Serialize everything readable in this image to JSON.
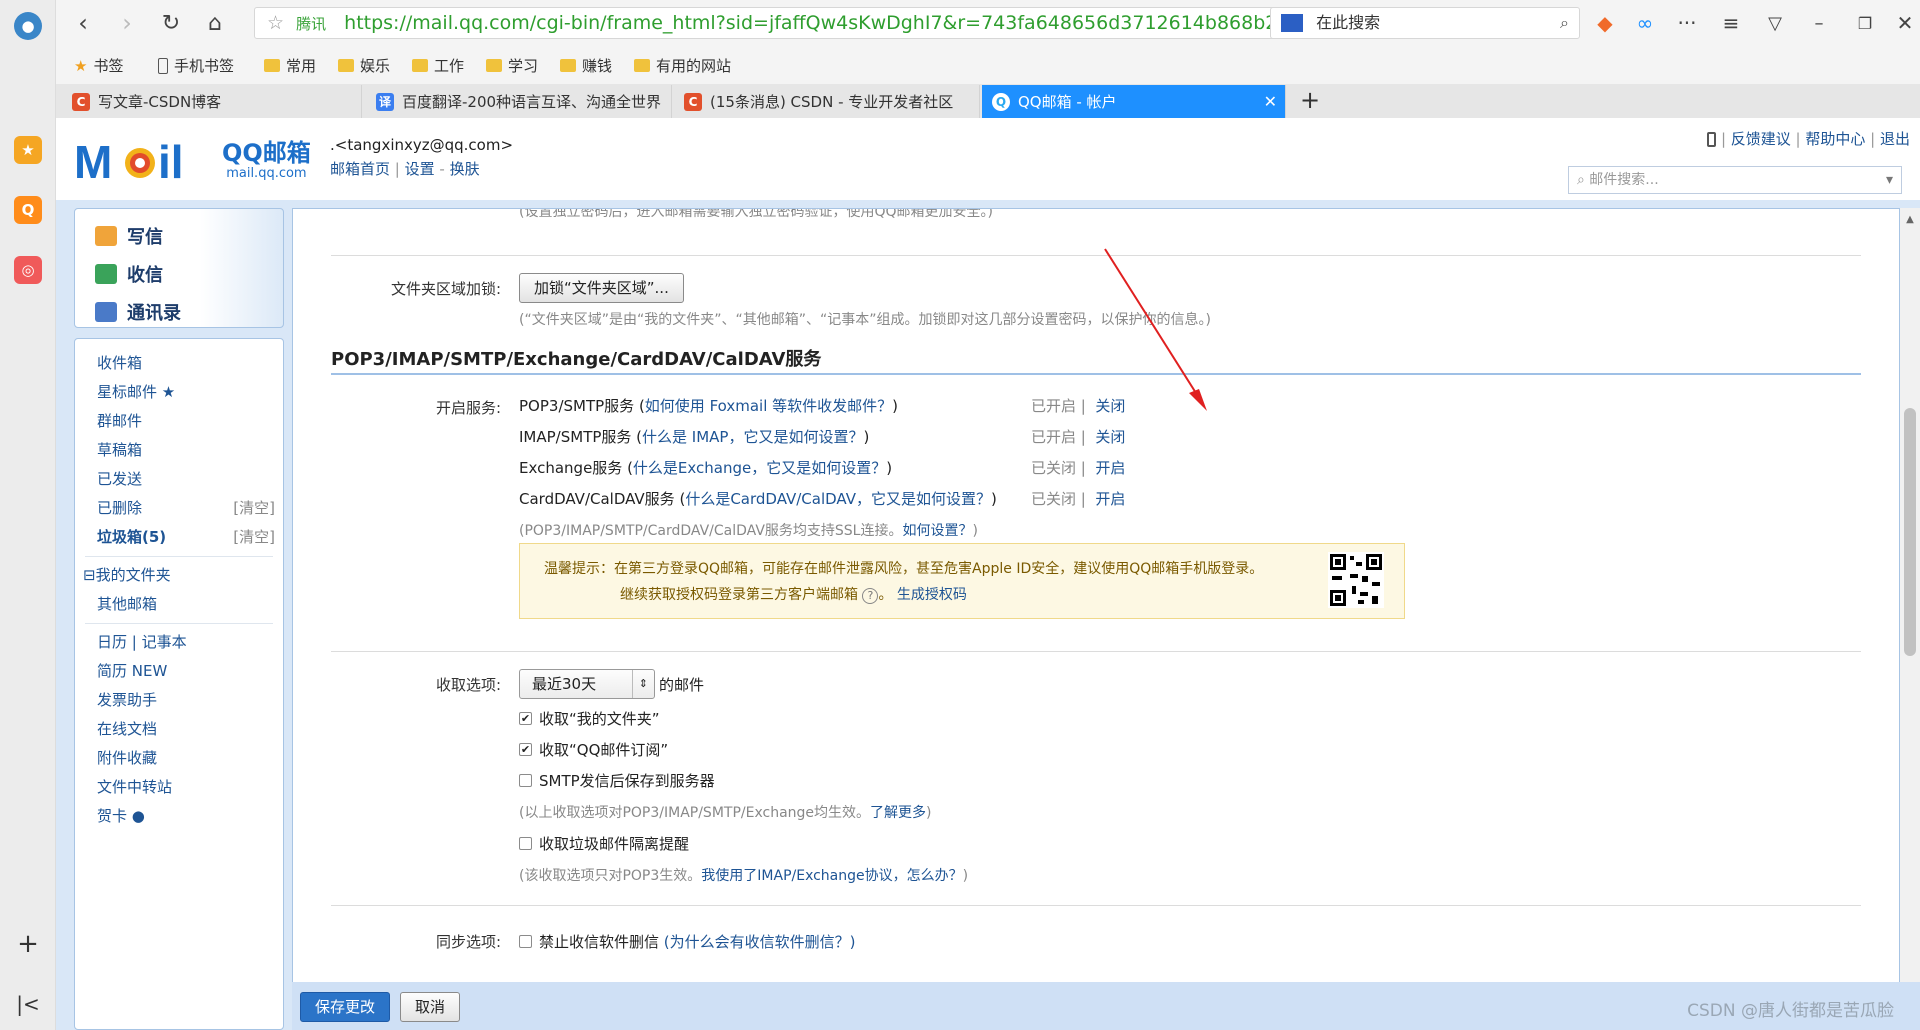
{
  "browser": {
    "brand": "腾讯",
    "url": "https://mail.qq.com/cgi-bin/frame_html?sid=jfaffQw4sKwDghI7&r=743fa648656d3712614b868b2",
    "search_placeholder": "在此搜索",
    "bookmarks": [
      "书签",
      "手机书签",
      "常用",
      "娱乐",
      "工作",
      "学习",
      "赚钱",
      "有用的网站"
    ],
    "tabs": [
      {
        "label": "写文章-CSDN博客",
        "icon": "C",
        "color": "#e2502c"
      },
      {
        "label": "百度翻译-200种语言互译、沟通全世界",
        "icon": "译",
        "color": "#3b7ef0"
      },
      {
        "label": "(15条消息) CSDN - 专业开发者社区",
        "icon": "C",
        "color": "#e2502c"
      },
      {
        "label": "QQ邮箱 - 帐户",
        "icon": "Q",
        "color": "#2aa9f0"
      }
    ],
    "new_tab": "+"
  },
  "mail": {
    "logo_text": "QQ邮箱",
    "logo_sub": "mail.qq.com",
    "user": ".<tangxinxyz@qq.com>",
    "user_links": [
      "邮箱首页",
      "设置",
      "换肤"
    ],
    "top_links": [
      "反馈建议",
      "帮助中心",
      "退出"
    ],
    "search_placeholder": "邮件搜索...",
    "quick": [
      "写信",
      "收信",
      "通讯录"
    ],
    "folders": [
      {
        "name": "收件箱",
        "extra": ""
      },
      {
        "name": "星标邮件 ★",
        "extra": ""
      },
      {
        "name": "群邮件",
        "extra": ""
      },
      {
        "name": "草稿箱",
        "extra": ""
      },
      {
        "name": "已发送",
        "extra": ""
      },
      {
        "name": "已删除",
        "extra": "[清空]"
      },
      {
        "name": "垃圾箱(5)",
        "extra": "[清空]"
      }
    ],
    "my_folders": "⊟我的文件夹",
    "other_mail": "其他邮箱",
    "tools": [
      "日历 | 记事本",
      "简历 NEW",
      "发票助手",
      "在线文档",
      "附件收藏",
      "文件中转站",
      "贺卡 ●"
    ]
  },
  "settings": {
    "top_note": "(设置独立密码后，进入邮箱需要输入独立密码验证，使用QQ邮箱更加安全。)",
    "folder_lock_label": "文件夹区域加锁:",
    "folder_lock_button": "加锁“文件夹区域”...",
    "folder_lock_note": "(“文件夹区域”是由“我的文件夹”、“其他邮箱”、“记事本”组成。加锁即对这几部分设置密码，以保护你的信息。)",
    "section_title": "POP3/IMAP/SMTP/Exchange/CardDAV/CalDAV服务",
    "service_label": "开启服务:",
    "services": [
      {
        "name": "POP3/SMTP服务",
        "help": "如何使用 Foxmail 等软件收发邮件？",
        "status": "已开启",
        "action": "关闭"
      },
      {
        "name": "IMAP/SMTP服务",
        "help": "什么是 IMAP，它又是如何设置？",
        "status": "已开启",
        "action": "关闭"
      },
      {
        "name": "Exchange服务",
        "help": "什么是Exchange，它又是如何设置？",
        "status": "已关闭",
        "action": "开启"
      },
      {
        "name": "CardDAV/CalDAV服务",
        "help": "什么是CardDAV/CalDAV，它又是如何设置？",
        "status": "已关闭",
        "action": "开启"
      }
    ],
    "ssl_note": "(POP3/IMAP/SMTP/CardDAV/CalDAV服务均支持SSL连接。",
    "ssl_link": "如何设置？",
    "tip_line1": "温馨提示：在第三方登录QQ邮箱，可能存在邮件泄露风险，甚至危害Apple ID安全，建议使用QQ邮箱手机版登录。",
    "tip_line2": "继续获取授权码登录第三方客户端邮箱",
    "tip_link": "生成授权码",
    "receive_label": "收取选项:",
    "receive_select": "最近30天",
    "receive_suffix": "的邮件",
    "options": [
      {
        "label": "收取“我的文件夹”",
        "checked": true
      },
      {
        "label": "收取“QQ邮件订阅”",
        "checked": true
      },
      {
        "label": "SMTP发信后保存到服务器",
        "checked": false
      }
    ],
    "option_note": "(以上收取选项对POP3/IMAP/SMTP/Exchange均生效。",
    "option_link": "了解更多",
    "spam_option": "收取垃圾邮件隔离提醒",
    "spam_note": "(该收取选项只对POP3生效。",
    "spam_link": "我使用了IMAP/Exchange协议，怎么办？",
    "sync_label": "同步选项:",
    "sync_option": "禁止收信软件删信",
    "sync_link": "(为什么会有收信软件删信？)",
    "save_button": "保存更改",
    "cancel_button": "取消",
    "watermark": "CSDN @唐人街都是苦瓜脸"
  }
}
